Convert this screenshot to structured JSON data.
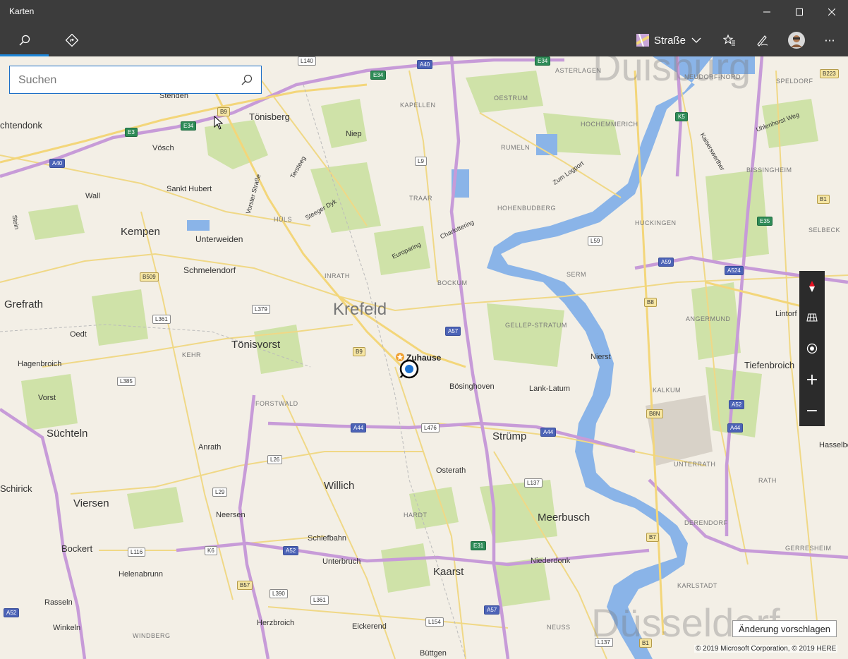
{
  "window": {
    "title": "Karten",
    "minimize": "—",
    "maximize": "☐",
    "close": "✕"
  },
  "toolbar": {
    "map_style": "Straße",
    "more": "···"
  },
  "search": {
    "placeholder": "Suchen",
    "value": ""
  },
  "map": {
    "home_label": "Zuhause",
    "big_city": "Krefeld",
    "watermark_top": "Duisburg",
    "watermark_bottom": "Düsseldorf",
    "cities": [
      "Kempen",
      "Tönisvorst",
      "Grefrath",
      "Willich",
      "Viersen",
      "Süchteln",
      "Meerbusch",
      "Kaarst",
      "Strümp",
      "Tönisberg",
      "Schmelendorf",
      "Unterweiden",
      "Bockert",
      "Tiefenbroich",
      "chtendonk",
      "Schirick"
    ],
    "towns": [
      "Stenden",
      "Vösch",
      "Niep",
      "Wall",
      "Sankt Hubert",
      "Oedt",
      "Hagenbroich",
      "Vorst",
      "Anrath",
      "Neersen",
      "Schiefbahn",
      "Unterbruch",
      "Helenabrunn",
      "Rasseln",
      "Winkeln",
      "Herzbroich",
      "Eickerend",
      "Büttgen",
      "Osterath",
      "Bösinghoven",
      "Lank-Latum",
      "Nierst",
      "Lintorf",
      "Hasselbe",
      "Niederdonk",
      "Uhlenhorst Weg",
      "Zum Logport",
      "Steeger Dyk",
      "Europaring",
      "Charlottering",
      "Vorster Straße",
      "Kaiserswerther",
      "Tersteeg",
      "Stein"
    ],
    "districts": [
      "ASTERLAGEN",
      "KAPELLEN",
      "OESTRUM",
      "HOCHEMMERICH",
      "RUMELN",
      "TRAAR",
      "HOHENBUDBERG",
      "HÜLS",
      "INRATH",
      "BOCKUM",
      "SERM",
      "GELLEP-STRATUM",
      "HUCKINGEN",
      "ANGERMUND",
      "KALKUM",
      "FORSTWALD",
      "KEHR",
      "HARDT",
      "UNTERRATH",
      "RATH",
      "DERENDORF",
      "GERRESHEIM",
      "KARLSTADT",
      "NEUSS",
      "WINDBERG",
      "NEUDORF-NORD",
      "SPELDORF",
      "BISSINGHEIM",
      "SELBECK"
    ],
    "roads": {
      "A40": "A40",
      "A44": "A44",
      "A57": "A57",
      "A52": "A52",
      "A59": "A59",
      "A524": "A524",
      "E34": "E34",
      "E3": "E3",
      "E31": "E31",
      "E35": "E35",
      "K5": "K5",
      "K6": "K6",
      "B9": "B9",
      "B509": "B509",
      "B1": "B1",
      "B8": "B8",
      "B8N": "B8N",
      "B7": "B7",
      "B57": "B57",
      "L140": "L140",
      "L379": "L379",
      "L361": "L361",
      "L385": "L385",
      "L476": "L476",
      "L26": "L26",
      "L29": "L29",
      "L116": "L116",
      "L390": "L390",
      "L361b": "L361",
      "L154": "L154",
      "L137": "L137",
      "L137b": "L137",
      "L59": "L59",
      "L9": "L9",
      "B223": "B223"
    },
    "copyright": "© 2019 Microsoft Corporation, © 2019 HERE",
    "suggest_button": "Änderung vorschlagen",
    "colors": {
      "land": "#f3efe6",
      "water": "#8ab4e8",
      "forest": "#c8dea0",
      "motorway": "#c79bd8",
      "primary": "#f3d67a",
      "secondary": "#ffffff",
      "location_blue": "#1d73d1"
    }
  },
  "controls": {
    "compass": "compass-icon",
    "aerial": "aerial-icon",
    "locate": "locate-icon",
    "zoom_in": "+",
    "zoom_out": "−"
  }
}
